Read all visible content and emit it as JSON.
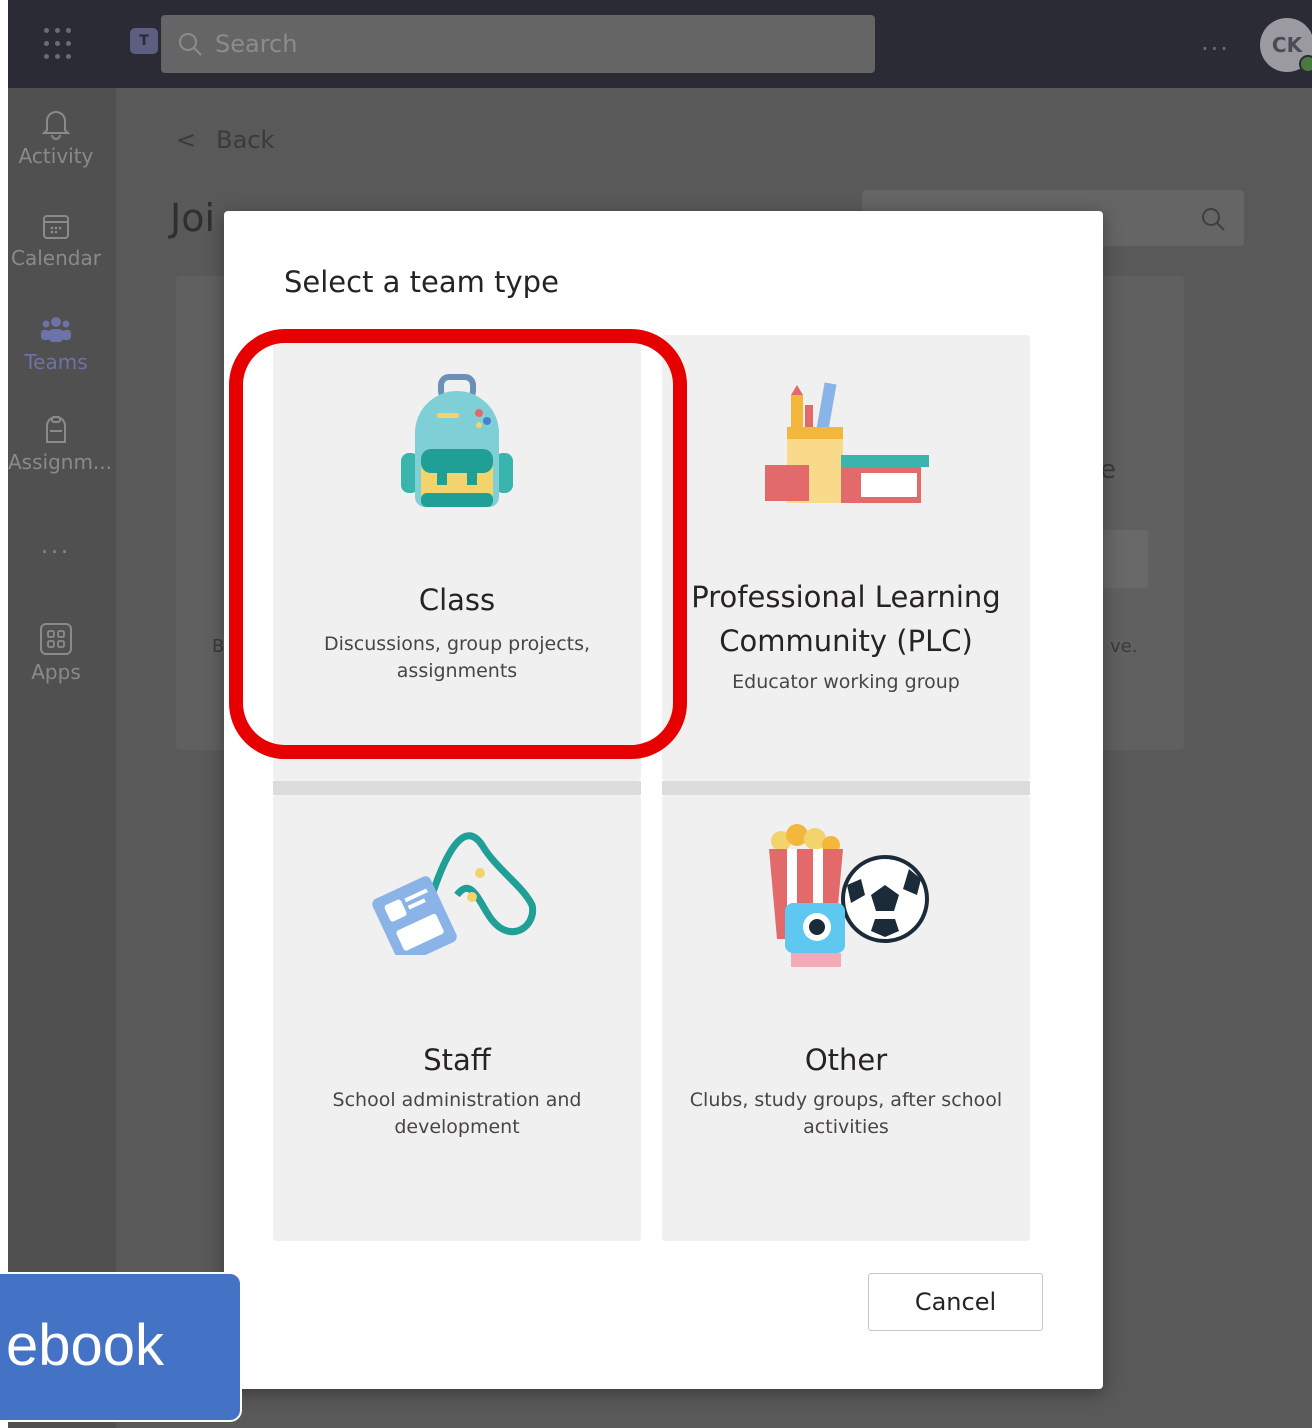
{
  "topbar": {
    "search_placeholder": "Search",
    "more_label": "...",
    "avatar_initials": "CK"
  },
  "rail": {
    "items": [
      {
        "label": "Activity",
        "icon": "bell-icon"
      },
      {
        "label": "Calendar",
        "icon": "calendar-icon"
      },
      {
        "label": "Teams",
        "icon": "teams-icon"
      },
      {
        "label": "Assignm...",
        "icon": "assignments-icon"
      },
      {
        "label": "Apps",
        "icon": "apps-icon"
      }
    ],
    "more_label": "..."
  },
  "background": {
    "back_label": "Back",
    "title_fragment": "Joi",
    "fragment_right": "e",
    "fragment_right2": "ve.",
    "fragment_left": "B"
  },
  "modal": {
    "title": "Select a team type",
    "tiles": [
      {
        "name": "Class",
        "desc": "Discussions, group projects, assignments",
        "icon": "backpack-icon"
      },
      {
        "name": "Professional Learning Community (PLC)",
        "desc": "Educator working group",
        "icon": "pencil-cup-books-icon"
      },
      {
        "name": "Staff",
        "desc": "School administration and development",
        "icon": "id-badge-lanyard-icon"
      },
      {
        "name": "Other",
        "desc": "Clubs, study groups, after school activities",
        "icon": "popcorn-camera-ball-icon"
      }
    ],
    "cancel_label": "Cancel"
  },
  "callout": {
    "text": "ebook"
  },
  "colors": {
    "highlight": "#e60000",
    "callout": "#4472c4",
    "topbar": "#2b2b35"
  }
}
